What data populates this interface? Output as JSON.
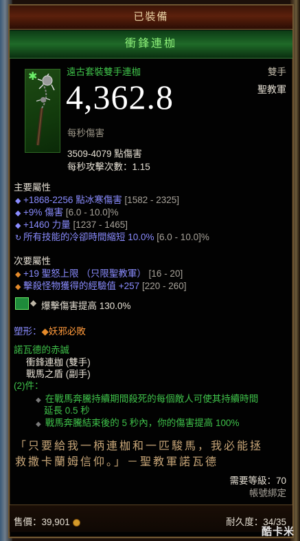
{
  "header": {
    "equipped_label": "已裝備"
  },
  "item": {
    "name": "衝鋒連枷",
    "type": "遠古套裝雙手連枷",
    "handedness": "雙手",
    "class_restriction": "聖教軍",
    "dps_value": "4,362.8",
    "dps_label": "每秒傷害",
    "damage_range": "3509-4079 點傷害",
    "attacks_per_second": "每秒攻擊次數：1.15"
  },
  "primary": {
    "heading": "主要屬性",
    "stats": [
      {
        "icon": "diamond-bullet-icon",
        "text": "+1868-2256 點冰寒傷害",
        "range": "[1582 - 2325]"
      },
      {
        "icon": "diamond-bullet-icon",
        "text": "+9% 傷害",
        "range": "[6.0 - 10.0]%"
      },
      {
        "icon": "diamond-bullet-icon",
        "text": "+1460 力量",
        "range": "[1237 - 1465]"
      },
      {
        "icon": "reroll-icon",
        "text": "所有技能的冷卻時間縮短 10.0%",
        "range": "[6.0 - 10.0]%"
      }
    ]
  },
  "secondary": {
    "heading": "次要屬性",
    "stats": [
      {
        "icon": "diamond-bullet-icon",
        "text": "+19 聖怒上限 （只限聖教軍）",
        "range": "[16 - 20]"
      },
      {
        "icon": "diamond-bullet-icon",
        "text": "擊殺怪物獲得的經驗值 +257",
        "range": "[220 - 260]"
      }
    ]
  },
  "socket": {
    "gem_icon": "emerald-gem-icon",
    "text": "爆擊傷害提高 130.0%"
  },
  "transmog": {
    "label": "塑形：",
    "value": "妖邪必敗"
  },
  "set": {
    "name": "諾瓦德的赤誠",
    "pieces": [
      "衝鋒連枷 (雙手)",
      "戰馬之盾 (副手)"
    ],
    "bonus_label": "(2)件：",
    "bonus_lines": [
      "在戰馬奔騰持續期間殺死的每個敵人可使其持續時間",
      "延長 0.5 秒",
      "戰馬奔騰結束後的 5 秒內，你的傷害提高 100%"
    ]
  },
  "flavor": {
    "line1": "「只要給我一柄連枷和一匹駿馬，我必能拯",
    "line2": "救撒卡蘭姆信仰。」－聖教軍諾瓦德"
  },
  "requirements": {
    "level": "需要等級：70",
    "binding": "帳號綁定"
  },
  "footer": {
    "sell_label": "售價：39,901",
    "durability": "耐久度：34/35"
  },
  "watermark": "酷卡米",
  "colors": {
    "set_green": "#3fc24a",
    "magic_blue": "#8a8cff",
    "legendary_orange": "#ff9a3c",
    "gold": "#c8a678"
  }
}
